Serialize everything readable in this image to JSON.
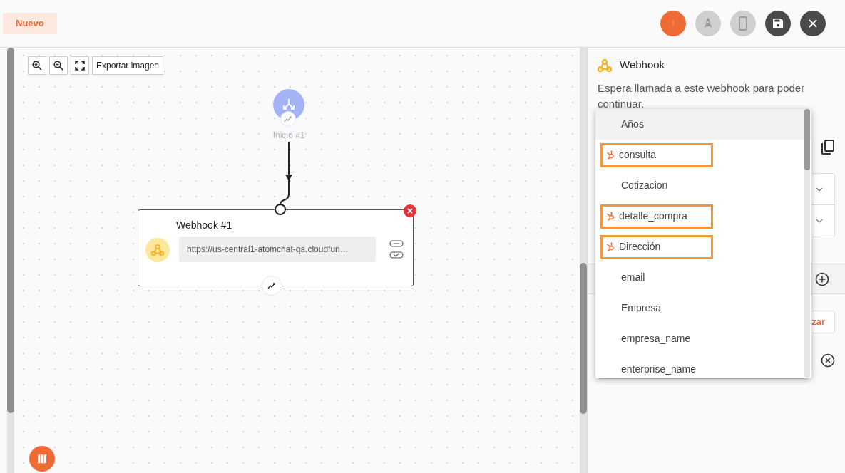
{
  "header": {
    "status_badge": "Nuevo",
    "buttons": [
      {
        "kind": "alert",
        "disabled": false
      },
      {
        "kind": "rocket",
        "disabled": true
      },
      {
        "kind": "phone",
        "disabled": true
      },
      {
        "kind": "save",
        "disabled": false
      },
      {
        "kind": "close",
        "disabled": false
      }
    ]
  },
  "canvas": {
    "export_label": "Exportar imagen",
    "nodes": [
      {
        "kind": "start",
        "label": "Inicio #1"
      },
      {
        "kind": "webhook",
        "title": "Webhook #1",
        "url": "https://us-central1-atomchat-qa.cloudfun…"
      }
    ]
  },
  "panel": {
    "title": "Webhook",
    "description": "Espera llamada a este webhook para poder continuar.",
    "partial_button": "zar",
    "dropdown": {
      "items": [
        {
          "label": "Años",
          "kind": "plain",
          "selected": true
        },
        {
          "label": "consulta",
          "kind": "hubspot",
          "selected": false
        },
        {
          "label": "Cotizacion",
          "kind": "plain",
          "selected": false
        },
        {
          "label": "detalle_compra",
          "kind": "hubspot",
          "selected": false
        },
        {
          "label": "Dirección",
          "kind": "hubspot",
          "selected": false
        },
        {
          "label": "email",
          "kind": "plain",
          "selected": false
        },
        {
          "label": "Empresa",
          "kind": "plain",
          "selected": false
        },
        {
          "label": "empresa_name",
          "kind": "plain",
          "selected": false
        },
        {
          "label": "enterprise_name",
          "kind": "plain",
          "selected": false
        }
      ]
    }
  }
}
